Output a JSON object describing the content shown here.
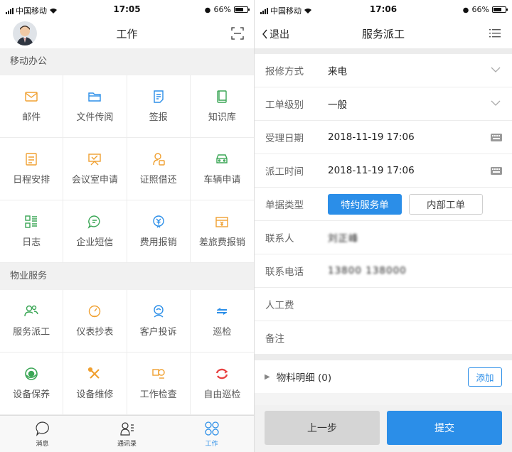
{
  "left": {
    "status": {
      "carrier": "中国移动",
      "time": "17:05",
      "battery": "66%"
    },
    "title": "工作",
    "sections": [
      {
        "title": "移动办公",
        "items": [
          {
            "label": "邮件",
            "icon": "mail-icon"
          },
          {
            "label": "文件传阅",
            "icon": "folder-icon"
          },
          {
            "label": "签报",
            "icon": "edit-doc-icon"
          },
          {
            "label": "知识库",
            "icon": "book-icon"
          },
          {
            "label": "日程安排",
            "icon": "calendar-doc-icon"
          },
          {
            "label": "会议室申请",
            "icon": "meeting-icon"
          },
          {
            "label": "证照借还",
            "icon": "license-icon"
          },
          {
            "label": "车辆申请",
            "icon": "car-icon"
          },
          {
            "label": "日志",
            "icon": "log-icon"
          },
          {
            "label": "企业短信",
            "icon": "message-icon"
          },
          {
            "label": "费用报销",
            "icon": "expense-icon"
          },
          {
            "label": "差旅费报销",
            "icon": "travel-expense-icon"
          }
        ]
      },
      {
        "title": "物业服务",
        "items": [
          {
            "label": "服务派工",
            "icon": "dispatch-icon"
          },
          {
            "label": "仪表抄表",
            "icon": "meter-icon"
          },
          {
            "label": "客户投诉",
            "icon": "complaint-icon"
          },
          {
            "label": "巡检",
            "icon": "arrows-icon"
          },
          {
            "label": "设备保养",
            "icon": "maintenance-icon"
          },
          {
            "label": "设备维修",
            "icon": "repair-icon"
          },
          {
            "label": "工作检查",
            "icon": "inspect-icon"
          },
          {
            "label": "自由巡检",
            "icon": "refresh-icon"
          }
        ]
      }
    ],
    "tabs": [
      {
        "label": "消息",
        "icon": "chat-icon"
      },
      {
        "label": "通讯录",
        "icon": "contacts-icon"
      },
      {
        "label": "工作",
        "icon": "work-icon"
      }
    ]
  },
  "right": {
    "status": {
      "carrier": "中国移动",
      "time": "17:06",
      "battery": "66%"
    },
    "back_label": "退出",
    "title": "服务派工",
    "form": {
      "repair_method": {
        "label": "报修方式",
        "value": "来电"
      },
      "order_level": {
        "label": "工单级别",
        "value": "一般"
      },
      "accept_date": {
        "label": "受理日期",
        "value": "2018-11-19 17:06"
      },
      "dispatch_time": {
        "label": "派工时间",
        "value": "2018-11-19 17:06"
      },
      "doc_type": {
        "label": "单据类型",
        "options": [
          "特约服务单",
          "内部工单"
        ],
        "selected": "特约服务单"
      },
      "contact": {
        "label": "联系人",
        "value": "刘正峰"
      },
      "phone": {
        "label": "联系电话",
        "value": "13800 138000"
      },
      "labor_cost": {
        "label": "人工费",
        "value": ""
      },
      "remark": {
        "label": "备注",
        "value": ""
      }
    },
    "materials": {
      "label": "物料明细 (0)",
      "add_label": "添加"
    },
    "actions": {
      "prev": "上一步",
      "submit": "提交"
    }
  },
  "colors": {
    "accent": "#2b8ee8",
    "orange": "#f0a030",
    "green": "#3aa655",
    "red": "#e84040"
  }
}
